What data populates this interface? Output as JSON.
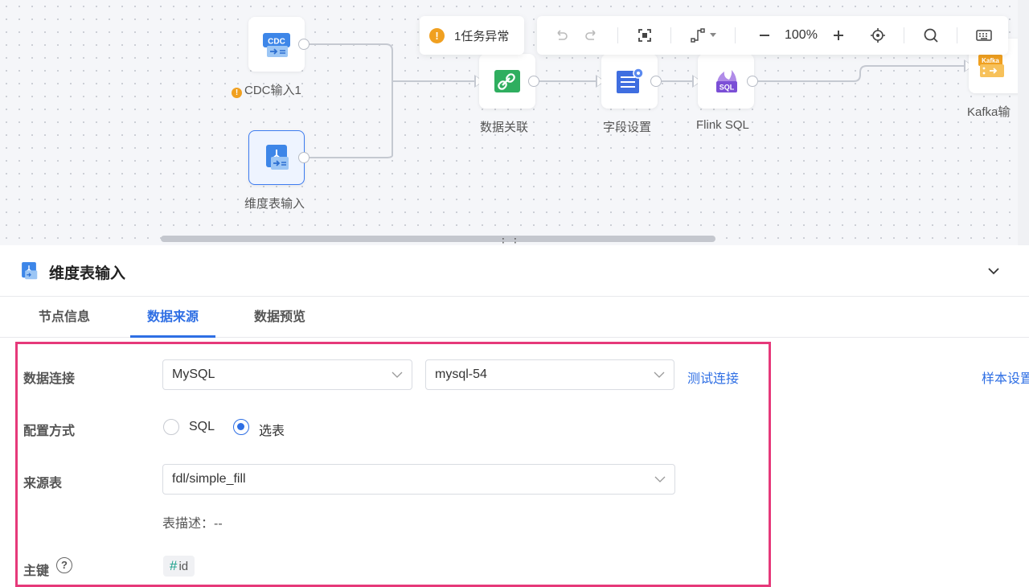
{
  "canvas": {
    "alert": {
      "text": "1任务异常"
    },
    "toolbar": {
      "zoom": "100%"
    },
    "nodes": {
      "cdc": {
        "icon_text": "CDC",
        "label": "CDC输入1",
        "warning": true
      },
      "dim": {
        "label": "维度表输入"
      },
      "join": {
        "label": "数据关联"
      },
      "field": {
        "label": "字段设置"
      },
      "sql": {
        "icon_text": "SQL",
        "label": "Flink SQL"
      },
      "kafka": {
        "icon_text": "Kafka",
        "label": "Kafka输"
      }
    }
  },
  "panel": {
    "title": "维度表输入",
    "tabs": [
      "节点信息",
      "数据来源",
      "数据预览"
    ],
    "active_tab": "数据来源",
    "form": {
      "connection_label": "数据连接",
      "connection_type": "MySQL",
      "connection_name": "mysql-54",
      "test_link": "测试连接",
      "sample_link": "样本设置",
      "config_label": "配置方式",
      "config_options": [
        "SQL",
        "选表"
      ],
      "config_selected": "选表",
      "source_label": "来源表",
      "source_table": "fdl/simple_fill",
      "table_desc": "表描述：--",
      "pk_label": "主键",
      "pk_help": "?",
      "pk_value": "id"
    }
  },
  "colors": {
    "accent": "#2f6fe4",
    "highlight": "#e6397a",
    "warning": "#f0a020"
  }
}
